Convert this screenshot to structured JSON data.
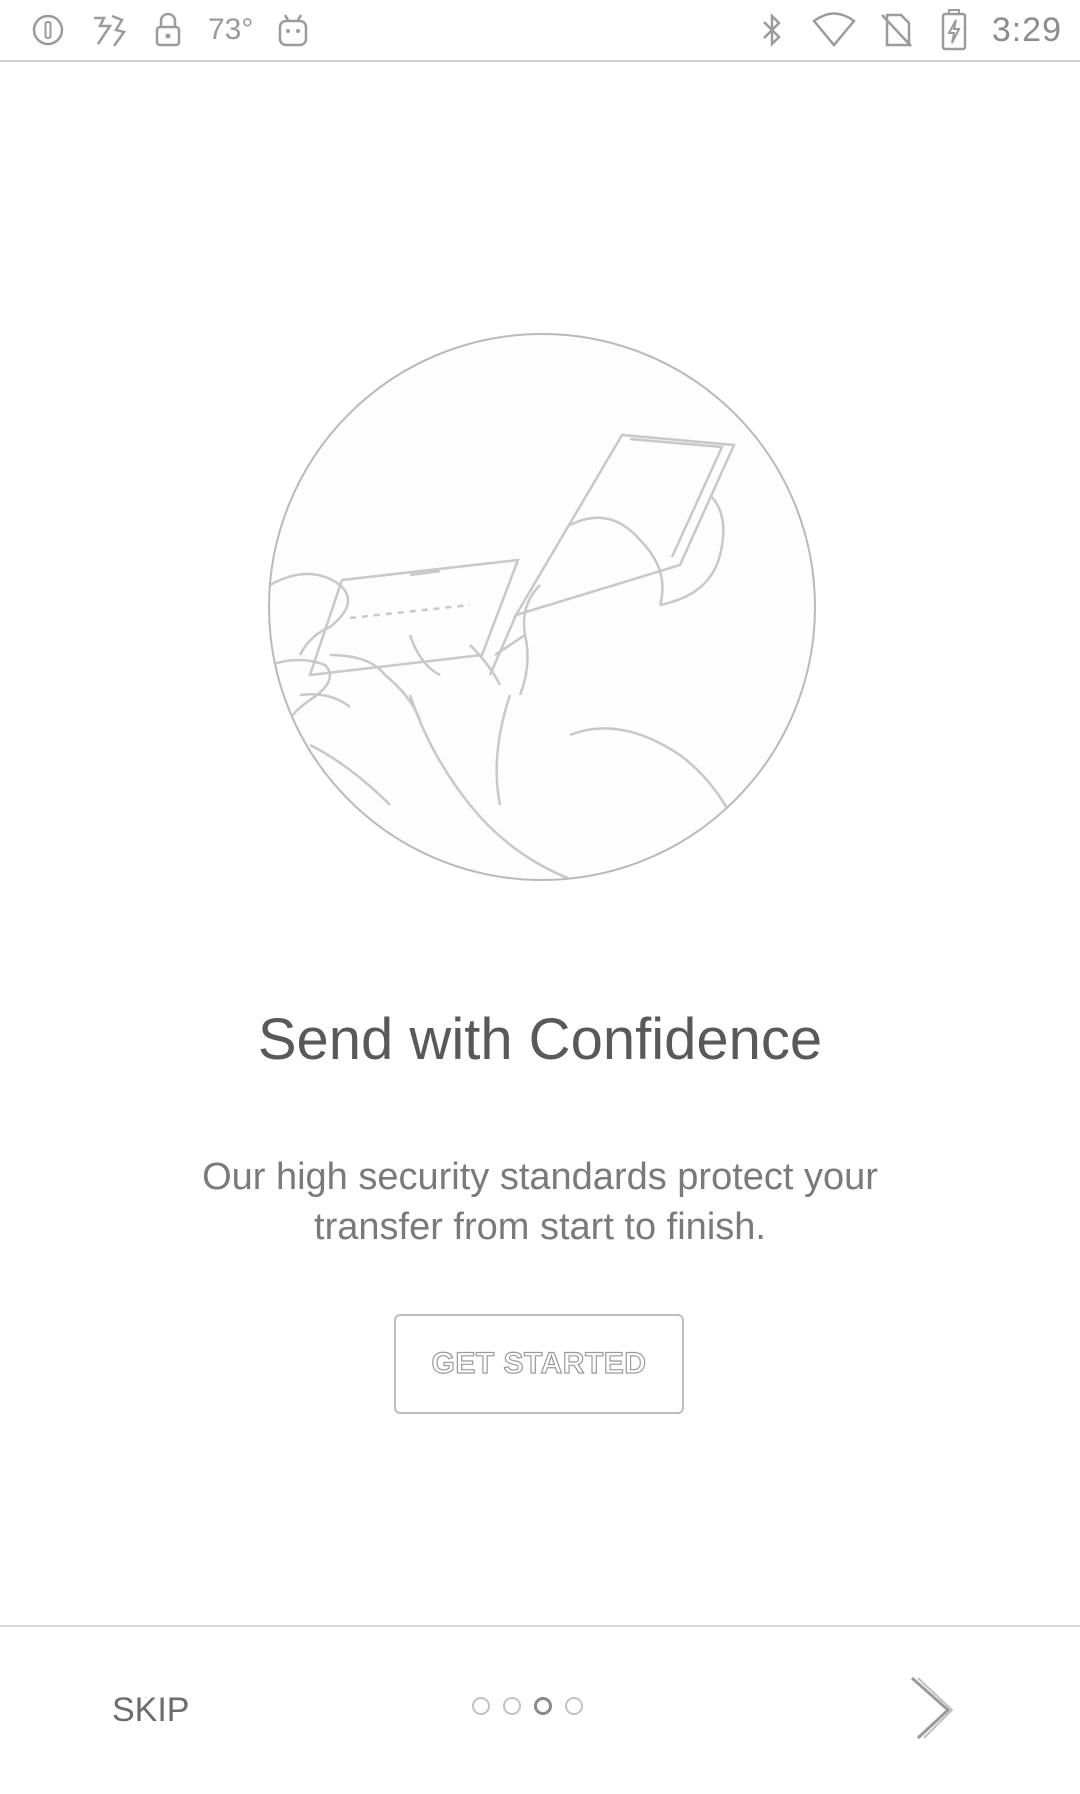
{
  "status_bar": {
    "left_icons": [
      "info-icon",
      "sports-icon",
      "lock-icon",
      "android-icon"
    ],
    "temperature": "73°",
    "right_icons": [
      "bluetooth-icon",
      "wifi-icon",
      "no-sim-icon",
      "battery-charging-icon"
    ],
    "clock": "3:29"
  },
  "onboarding": {
    "hero_image": "hands-card-phone-image",
    "headline": "Send with Confidence",
    "body_line1": "Our high security standards protect your",
    "body_line2": "transfer from start to finish.",
    "cta_label": "GET STARTED"
  },
  "bottom_nav": {
    "skip_label": "SKIP",
    "page_count": 4,
    "current_page": 3,
    "next_icon": "chevron-right-icon"
  }
}
